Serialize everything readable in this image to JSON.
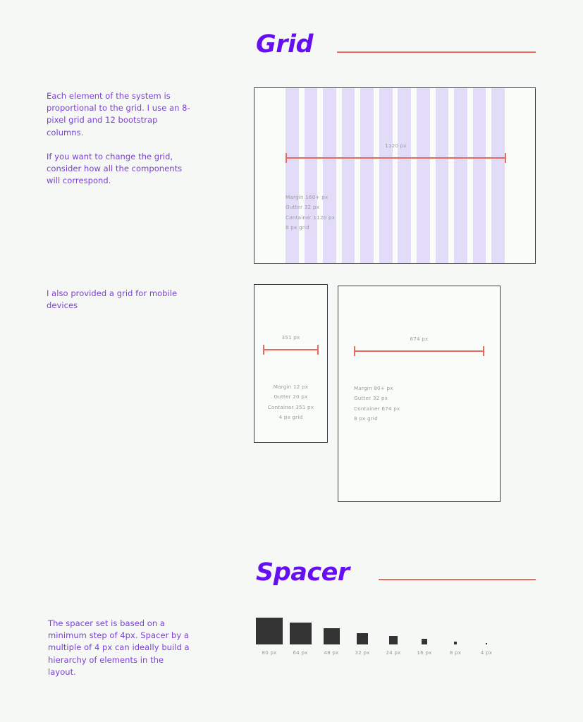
{
  "colors": {
    "background": "#f6f8f6",
    "heading": "#6610f2",
    "body_text": "#7b3fd4",
    "accent_rule": "#e8695e",
    "column_fill": "#e3dcf9",
    "frame_border": "#3b3f45",
    "spec_text": "#9a9a9a",
    "spacer_fill": "#333333"
  },
  "grid_section": {
    "heading": "Grid",
    "intro_paragraphs": [
      "Each element of the system is proportional to the grid. I use an 8-pixel grid and 12 bootstrap columns.",
      "If you want to change the grid, consider how all the components will correspond."
    ],
    "mobile_note": "I also provided a grid for mobile devices",
    "desktop_frame": {
      "name": "desktop-grid",
      "columns": 12,
      "measure_label": "1120 px",
      "specs": [
        "Margin 160+ px",
        "Gutter 32 px",
        "Container 1120 px",
        "8 px grid"
      ]
    },
    "mobile_frame": {
      "name": "mobile-grid",
      "measure_label": "351 px",
      "specs": [
        "Margin 12 px",
        "Gutter 20 px",
        "Container 351 px",
        "4 px grid"
      ]
    },
    "tablet_frame": {
      "name": "tablet-grid",
      "measure_label": "674 px",
      "specs": [
        "Margin 80+ px",
        "Gutter 32 px",
        "Container 674 px",
        "8 px grid"
      ]
    }
  },
  "spacer_section": {
    "heading": "Spacer",
    "intro_paragraphs": [
      "The spacer set is based on a minimum step of 4px. Spacer by a multiple of 4 px can ideally build a hierarchy of elements in the layout."
    ],
    "swatches": [
      {
        "label": "80 px",
        "size": 38
      },
      {
        "label": "64 px",
        "size": 31
      },
      {
        "label": "48 px",
        "size": 23
      },
      {
        "label": "32 px",
        "size": 16
      },
      {
        "label": "24 px",
        "size": 12
      },
      {
        "label": "16 px",
        "size": 8
      },
      {
        "label": "8 px",
        "size": 4
      },
      {
        "label": "4 px",
        "size": 2
      }
    ]
  }
}
